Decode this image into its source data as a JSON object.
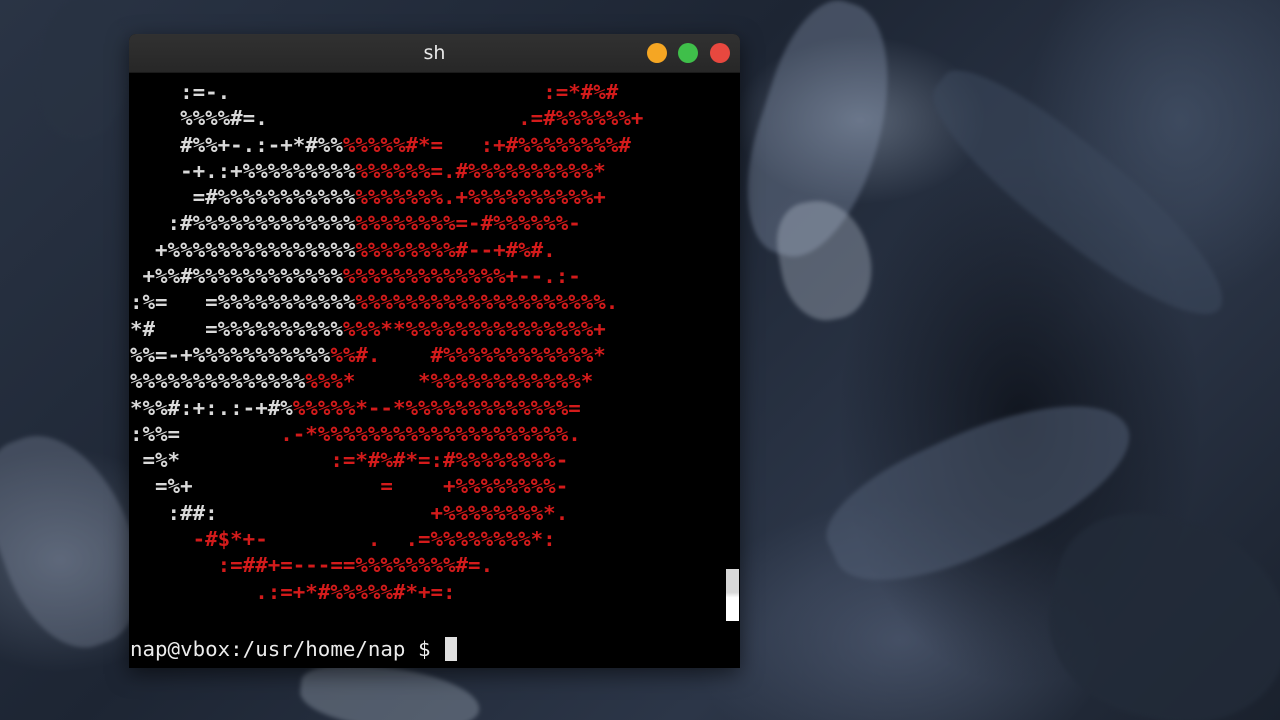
{
  "window": {
    "title": "sh",
    "controls": [
      {
        "name": "minimize",
        "color": "#f5a623"
      },
      {
        "name": "maximize",
        "color": "#3fbf4a"
      },
      {
        "name": "close",
        "color": "#e8483f"
      }
    ]
  },
  "colors": {
    "background": "#000000",
    "art_white": "#d9d9d9",
    "art_red": "#d31b1b",
    "text": "#ececec",
    "cursor": "#e0e0e0"
  },
  "ascii_art": [
    [
      [
        "w",
        "    :=-."
      ],
      [
        "r",
        "                         :=*#%#"
      ]
    ],
    [
      [
        "w",
        "    %%%%#=."
      ],
      [
        "r",
        "                    .=#%%%%%%+"
      ]
    ],
    [
      [
        "w",
        "    #%%+-.:-+*#%%"
      ],
      [
        "r",
        "%%%%%#*=   :+#%%%%%%%%#"
      ]
    ],
    [
      [
        "w",
        "    -+.:+%%%%%%%%%"
      ],
      [
        "r",
        "%%%%%%=.#%%%%%%%%%%*"
      ]
    ],
    [
      [
        "w",
        "     =#%%%%%%%%%%%"
      ],
      [
        "r",
        "%%%%%%%.+%%%%%%%%%%+"
      ]
    ],
    [
      [
        "w",
        "   :#%%%%%%%%%%%%%"
      ],
      [
        "r",
        "%%%%%%%%=-#%%%%%%-"
      ]
    ],
    [
      [
        "w",
        "  +%%%%%%%%%%%%%%%"
      ],
      [
        "r",
        "%%%%%%%%#--+#%#."
      ]
    ],
    [
      [
        "w",
        " +%%#%%%%%%%%%%%%"
      ],
      [
        "r",
        "%%%%%%%%%%%%%+--.:-"
      ]
    ],
    [
      [
        "w",
        ":%=   =%%%%%%%%%%%"
      ],
      [
        "r",
        "%%%%%%%%%%%%%%%%%%%%."
      ]
    ],
    [
      [
        "w",
        "*#    =%%%%%%%%%%"
      ],
      [
        "r",
        "%%%**%%%%%%%%%%%%%%%+"
      ]
    ],
    [
      [
        "w",
        "%%=-+%%%%%%%%%%%"
      ],
      [
        "r",
        "%%#.    #%%%%%%%%%%%%*"
      ]
    ],
    [
      [
        "w",
        "%%%%%%%%%%%%%%"
      ],
      [
        "r",
        "%%%*     *%%%%%%%%%%%%*"
      ]
    ],
    [
      [
        "w",
        "*%%#:+:.:-+#%"
      ],
      [
        "r",
        "%%%%%*--*%%%%%%%%%%%%%="
      ]
    ],
    [
      [
        "w",
        ":%%=        "
      ],
      [
        "r",
        ".-*%%%%%%%%%%%%%%%%%%%%."
      ]
    ],
    [
      [
        "w",
        " =%*        "
      ],
      [
        "r",
        "    :=*#%#*=:#%%%%%%%%-"
      ]
    ],
    [
      [
        "w",
        "  =%+       "
      ],
      [
        "r",
        "        =    +%%%%%%%%-"
      ]
    ],
    [
      [
        "w",
        "   :##:     "
      ],
      [
        "r",
        "            +%%%%%%%%*."
      ]
    ],
    [
      [
        "w",
        ""
      ],
      [
        "r",
        "     -#$*+-        .  .=%%%%%%%%*:"
      ]
    ],
    [
      [
        "w",
        ""
      ],
      [
        "r",
        "       :=##+=---==%%%%%%%%#=."
      ]
    ],
    [
      [
        "w",
        ""
      ],
      [
        "r",
        "          .:=+*#%%%%%#*+=:"
      ]
    ]
  ],
  "prompt": {
    "text": "nap@vbox:/usr/home/nap $ "
  }
}
